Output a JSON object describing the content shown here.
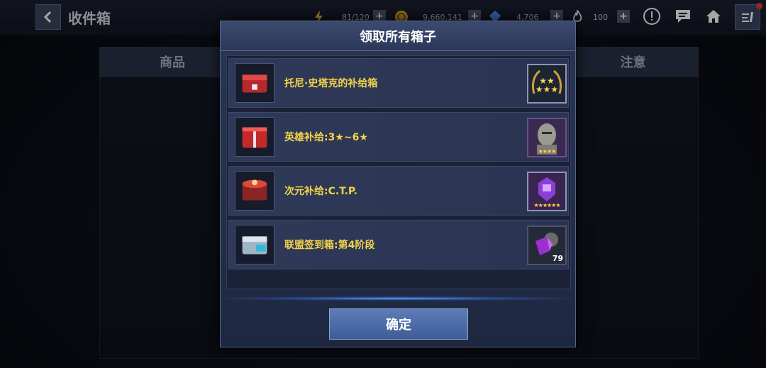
{
  "topbar": {
    "title": "收件箱",
    "energy": "81/120",
    "gold": "9,660,141",
    "crystals": "4,706",
    "flame": "100",
    "plus": "+"
  },
  "background": {
    "col_left": "商品",
    "col_right": "注意"
  },
  "modal": {
    "title": "领取所有箱子",
    "confirm_label": "确定",
    "items": [
      {
        "label": "托尼·史塔克的补给箱",
        "reward_icon": "gold-stars-badge-icon"
      },
      {
        "label": "英雄补给:3★~6★",
        "reward_icon": "armored-hero-portrait-icon",
        "reward_stars": "★★★★"
      },
      {
        "label": "次元补给:C.T.P.",
        "reward_icon": "purple-ctp-crystal-icon",
        "reward_stars": "★★★★★★"
      },
      {
        "label": "联盟签到箱:第4阶段",
        "reward_icon": "purple-gear-cube-icon",
        "reward_count": "79"
      }
    ]
  },
  "colors": {
    "gold_text": "#f4d24a",
    "accent_blue": "#5d7cb8",
    "modal_bg": "#2a3553"
  }
}
